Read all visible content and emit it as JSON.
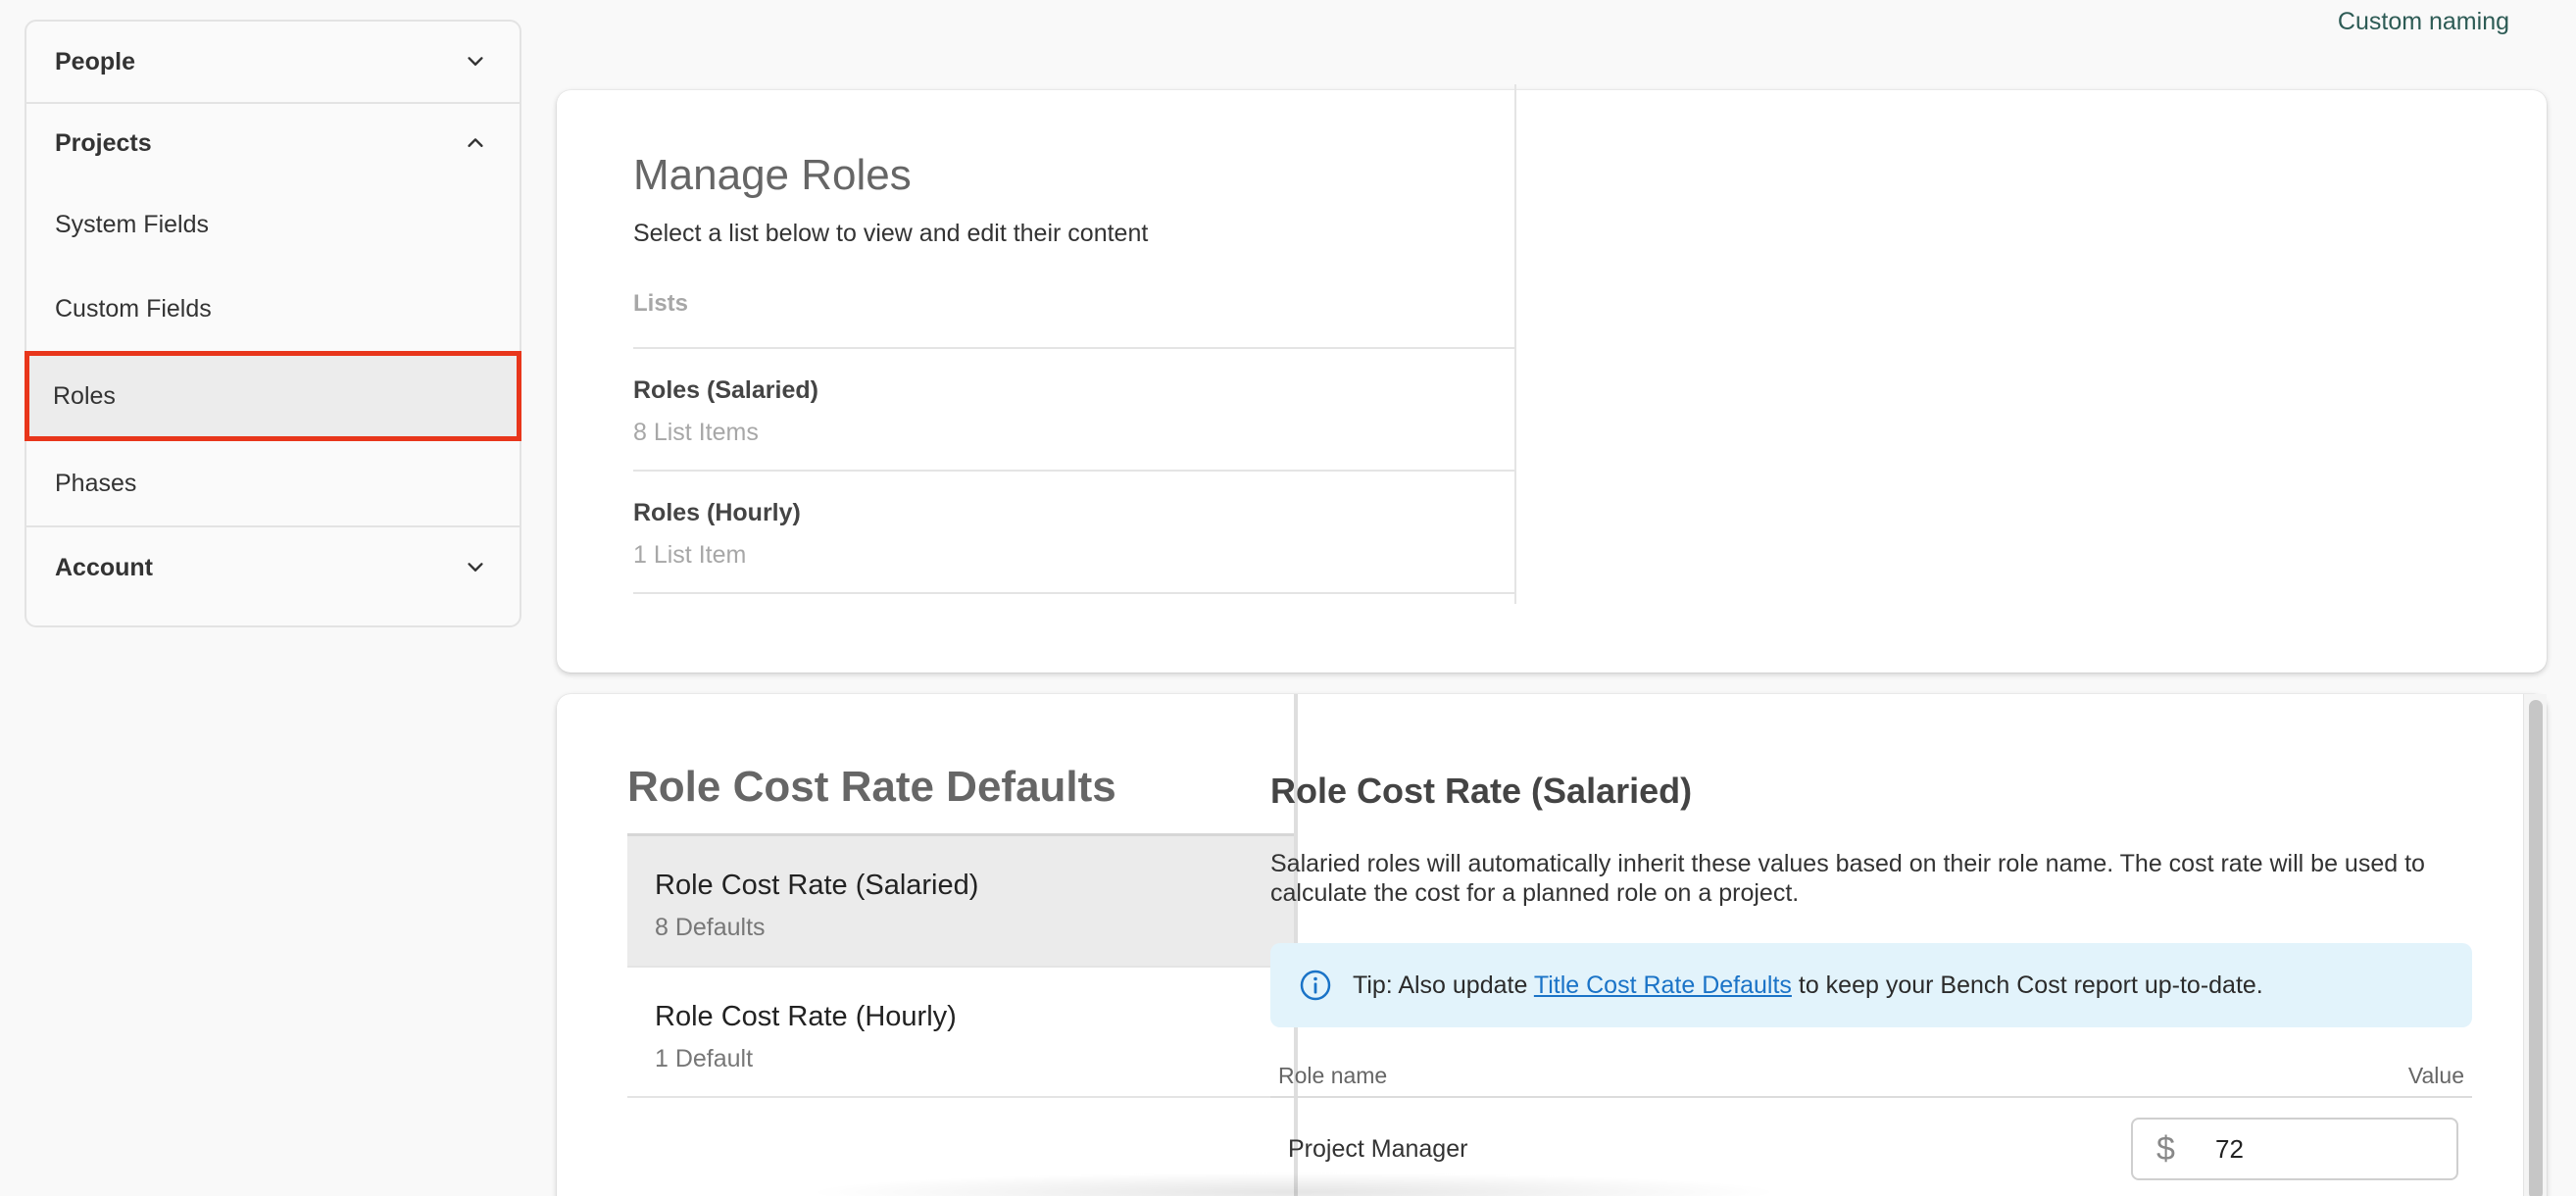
{
  "top_link": "Custom naming",
  "sidebar": {
    "sections": {
      "people": "People",
      "projects": "Projects",
      "account": "Account"
    },
    "items": [
      {
        "label": "System Fields"
      },
      {
        "label": "Custom Fields"
      },
      {
        "label": "Roles"
      },
      {
        "label": "Phases"
      }
    ]
  },
  "manage_roles": {
    "title": "Manage Roles",
    "subtitle": "Select a list below to view and edit their content",
    "lists_label": "Lists",
    "lists": [
      {
        "name": "Roles (Salaried)",
        "count": "8 List Items"
      },
      {
        "name": "Roles (Hourly)",
        "count": "1 List Item"
      }
    ]
  },
  "cost_defaults": {
    "title": "Role Cost Rate Defaults",
    "items": [
      {
        "name": "Role Cost Rate (Salaried)",
        "count": "8 Defaults"
      },
      {
        "name": "Role Cost Rate (Hourly)",
        "count": "1 Default"
      }
    ]
  },
  "detail": {
    "title": "Role Cost Rate (Salaried)",
    "description": "Salaried roles will automatically inherit these values based on their role name. The cost rate will be used to calculate the cost for a planned role on a project.",
    "tip_prefix": "Tip: Also update ",
    "tip_link": "Title Cost Rate Defaults",
    "tip_suffix": " to keep your Bench Cost report up-to-date.",
    "table": {
      "col_role": "Role name",
      "col_value": "Value",
      "rows": [
        {
          "role": "Project Manager",
          "currency": "$",
          "value": "72"
        }
      ]
    }
  },
  "colors": {
    "highlight_border": "#e8361b",
    "tip_background": "#e2f3fb",
    "link": "#1a73c7"
  }
}
